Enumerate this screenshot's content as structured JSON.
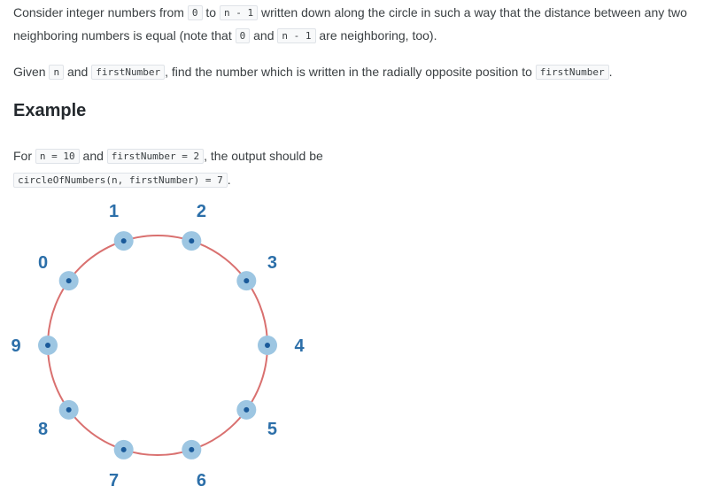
{
  "intro": {
    "line1": {
      "t1": "Consider integer numbers from ",
      "c1": "0",
      "t2": " to ",
      "c2": "n - 1",
      "t3": " written down along the circle in such a way that the distance between any two"
    },
    "line2": {
      "t1": "neighboring numbers is equal (note that ",
      "c1": "0",
      "t2": " and ",
      "c2": "n - 1",
      "t3": " are neighboring, too)."
    },
    "line3": {
      "t1": "Given ",
      "c1": "n",
      "t2": " and ",
      "c2": "firstNumber",
      "t3": ", find the number which is written in the radially opposite position to ",
      "c3": "firstNumber",
      "t4": "."
    }
  },
  "example": {
    "heading": "Example",
    "line1": {
      "t1": "For ",
      "c1": "n = 10",
      "t2": " and ",
      "c2": "firstNumber = 2",
      "t3": ", the output should be"
    },
    "line2": {
      "c1": "circleOfNumbers(n, firstNumber) = 7",
      "t1": "."
    }
  },
  "figure": {
    "labels": [
      "0",
      "1",
      "2",
      "3",
      "4",
      "5",
      "6",
      "7",
      "8",
      "9"
    ],
    "colors": {
      "circle": "#d9706f",
      "halo": "#9dc6e2",
      "dot": "#1a5a9a",
      "label": "#2c6fa9"
    }
  }
}
